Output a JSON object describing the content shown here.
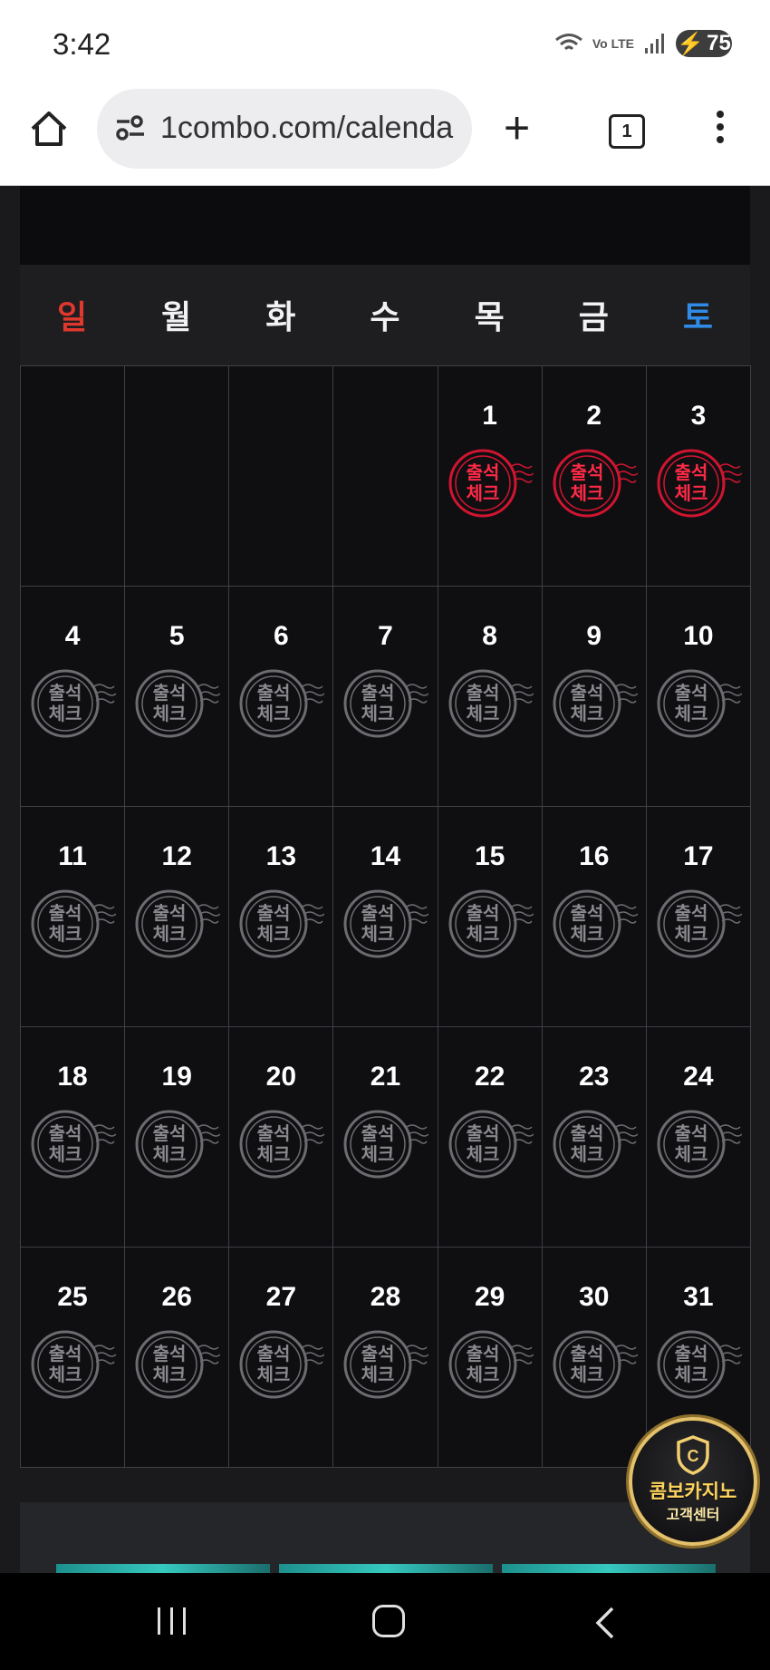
{
  "status_bar": {
    "time": "3:42",
    "network": "Vo LTE",
    "battery": "75"
  },
  "browser": {
    "url": "1combo.com/calenda",
    "tab_count": "1"
  },
  "calendar": {
    "weekdays": [
      "일",
      "월",
      "화",
      "수",
      "목",
      "금",
      "토"
    ],
    "weekday_colors": {
      "sunday": "#e0382c",
      "saturday": "#2f8be6",
      "default": "#f2f2f2"
    },
    "stamp_text": [
      "출석",
      "체크"
    ],
    "leading_blank_days": 4,
    "days_in_month": 31,
    "checked_days": [
      1,
      2,
      3
    ],
    "stamp_colors": {
      "checked": "#d01530",
      "unchecked": "#6c6c70"
    }
  },
  "support_badge": {
    "title": "콤보카지노",
    "subtitle": "고객센터"
  }
}
